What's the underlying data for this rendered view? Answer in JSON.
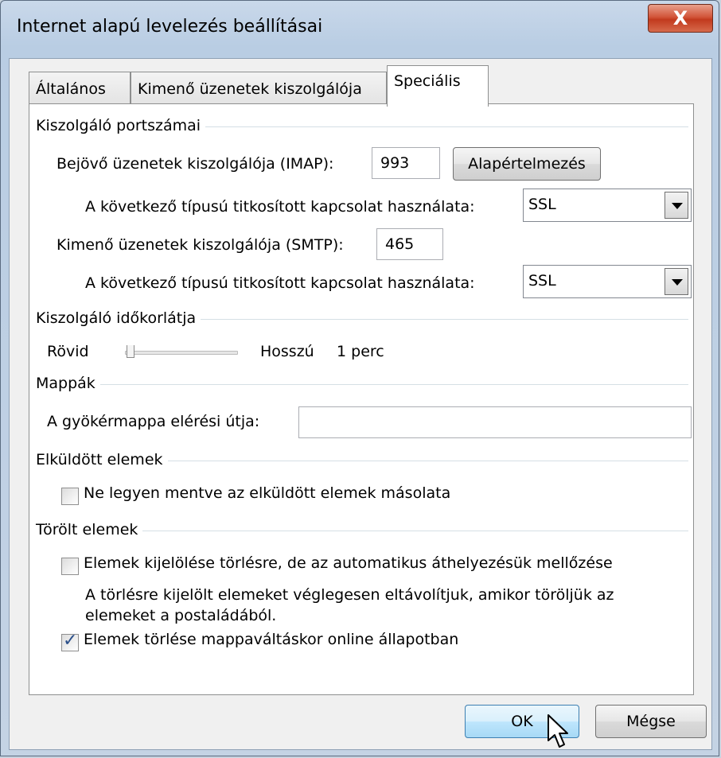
{
  "window": {
    "title": "Internet alapú levelezés beállításai",
    "close_label": "X"
  },
  "tabs": [
    {
      "label": "Általános",
      "active": false
    },
    {
      "label": "Kimenő üzenetek kiszolgálója",
      "active": false
    },
    {
      "label": "Speciális",
      "active": true
    }
  ],
  "server_ports": {
    "group_label": "Kiszolgáló portszámai",
    "incoming_label": "Bejövő üzenetek kiszolgálója (IMAP):",
    "incoming_value": "993",
    "default_button": "Alapértelmezés",
    "incoming_encryption_label": "A következő típusú titkosított kapcsolat használata:",
    "incoming_encryption_value": "SSL",
    "outgoing_label": "Kimenő üzenetek kiszolgálója (SMTP):",
    "outgoing_value": "465",
    "outgoing_encryption_label": "A következő típusú titkosított kapcsolat használata:",
    "outgoing_encryption_value": "SSL"
  },
  "timeout": {
    "group_label": "Kiszolgáló időkorlátja",
    "short_label": "Rövid",
    "long_label": "Hosszú",
    "value_text": "1 perc",
    "slider_level": 0.05
  },
  "folders": {
    "group_label": "Mappák",
    "root_path_label": "A gyökérmappa elérési útja:",
    "root_path_value": ""
  },
  "sent_items": {
    "group_label": "Elküldött elemek",
    "no_copy_label": "Ne legyen mentve az elküldött elemek másolata",
    "no_copy_checked": false
  },
  "deleted_items": {
    "group_label": "Törölt elemek",
    "mark_label": "Elemek kijelölése törlésre, de az automatikus áthelyezésük mellőzése",
    "mark_checked": false,
    "description_line1": "A törlésre kijelölt elemeket véglegesen eltávolítjuk, amikor töröljük az",
    "description_line2": "elemeket a postaládából.",
    "purge_label": "Elemek törlése mappaváltáskor online állapotban",
    "purge_checked": true
  },
  "footer": {
    "ok_label": "OK",
    "cancel_label": "Mégse"
  },
  "colors": {
    "check_mark": "#2b4f8a",
    "default_button_border": "#3c7fb1"
  }
}
